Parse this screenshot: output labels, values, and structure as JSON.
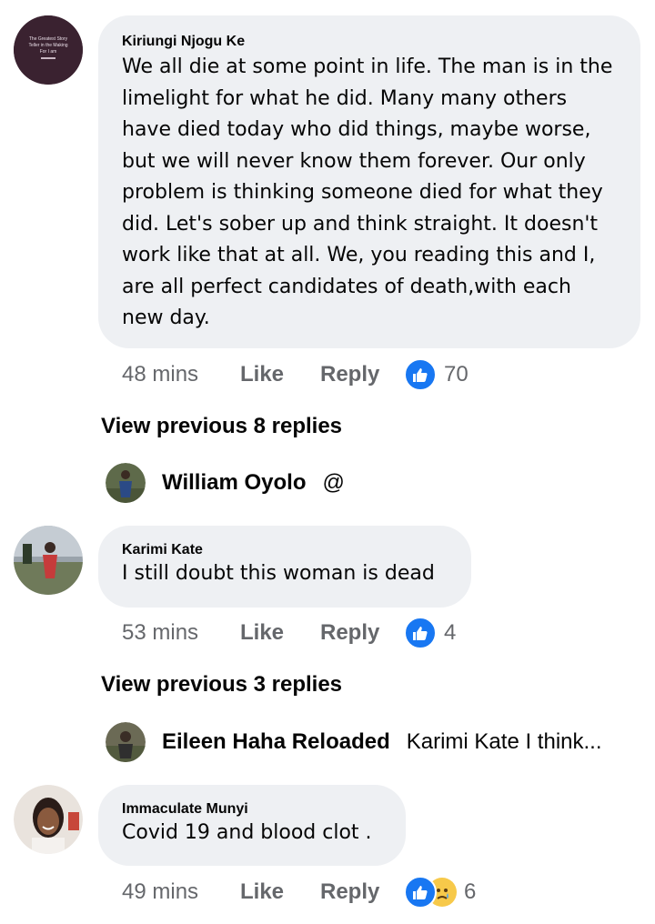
{
  "comments": [
    {
      "author": "Kiriungi Njogu Ke",
      "avatar_text": [
        "The Greatest Story",
        "Teller in the Making",
        "For I am"
      ],
      "lines": [
        "We all die at some point in life. The man is in the",
        "limelight for what he did. Many many others",
        "have died today who did things, maybe worse,",
        "but we will never know them forever. Our only",
        "problem is thinking someone died for what they",
        "did. Let's sober up and think straight. It doesn't",
        "work like that at all. We, you reading this and I,",
        "are all perfect candidates of death,with each",
        "new day."
      ],
      "time": "48 mins",
      "like_label": "Like",
      "reply_label": "Reply",
      "reaction_icon": "thumbs-up-icon",
      "reaction_count": "70"
    },
    {
      "author": "Karimi Kate",
      "lines": [
        "I still doubt this woman is dead"
      ],
      "time": "53 mins",
      "like_label": "Like",
      "reply_label": "Reply",
      "reaction_icon": "thumbs-up-icon",
      "reaction_count": "4"
    },
    {
      "author": "Immaculate Munyi",
      "lines": [
        "Covid 19 and blood clot ."
      ],
      "time": "49 mins",
      "like_label": "Like",
      "reply_label": "Reply",
      "reaction_icons": [
        "thumbs-up-icon",
        "sad-face-icon"
      ],
      "reaction_count": "6"
    }
  ],
  "threads": [
    {
      "view_previous": "View previous 8 replies",
      "reply_author": "William Oyolo",
      "reply_preview": "@"
    },
    {
      "view_previous": "View previous 3 replies",
      "reply_author": "Eileen Haha Reloaded",
      "reply_preview": "Karimi Kate I think..."
    }
  ],
  "colors": {
    "bubble": "#eef0f3",
    "meta_text": "#65676b",
    "like_blue": "#1877f2"
  }
}
